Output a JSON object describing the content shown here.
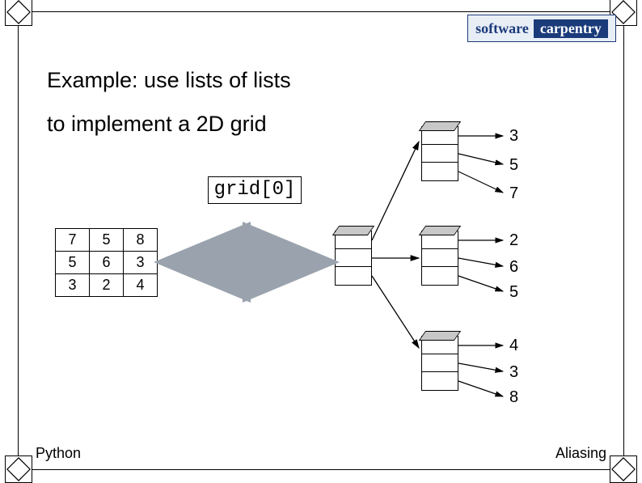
{
  "logo": {
    "software": "software",
    "carpentry": "carpentry"
  },
  "title": {
    "line1": "Example: use lists of lists",
    "line2": "to implement a 2D grid"
  },
  "grid_label": "grid[0]",
  "grid2d": {
    "rows": [
      [
        "7",
        "5",
        "8"
      ],
      [
        "5",
        "6",
        "3"
      ],
      [
        "3",
        "2",
        "4"
      ]
    ]
  },
  "values_right": {
    "group1": [
      "3",
      "5",
      "7"
    ],
    "group2": [
      "2",
      "6",
      "5"
    ],
    "group3": [
      "4",
      "3",
      "8"
    ]
  },
  "footer": {
    "left": "Python",
    "right": "Aliasing"
  }
}
